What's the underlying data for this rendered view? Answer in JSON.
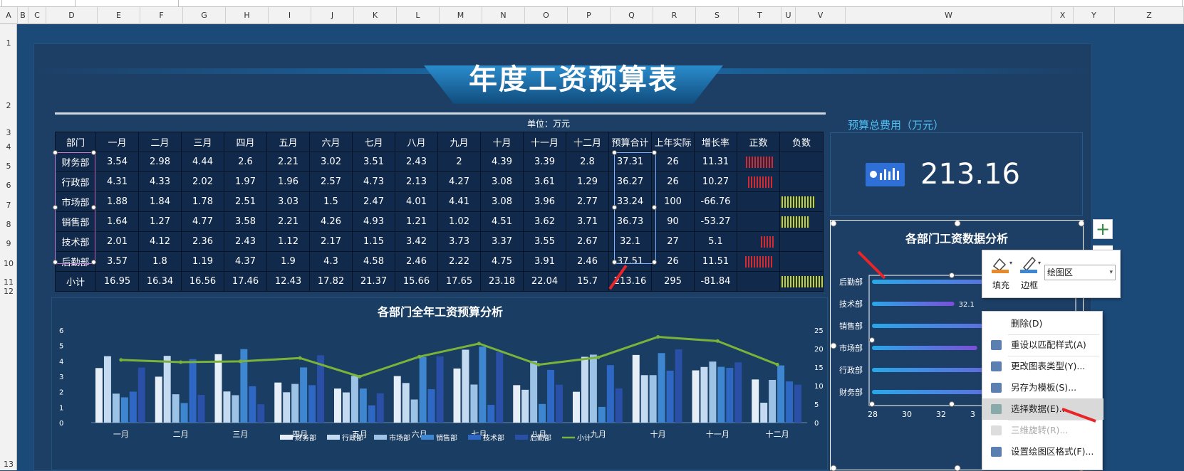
{
  "title": "年度工资预算表",
  "unit": "单位：万元",
  "columns": [
    "A",
    "B",
    "C",
    "D",
    "E",
    "F",
    "G",
    "H",
    "I",
    "J",
    "K",
    "L",
    "M",
    "N",
    "O",
    "P",
    "Q",
    "R",
    "S",
    "T",
    "U",
    "V",
    "W",
    "X",
    "Y",
    "Z"
  ],
  "rows": [
    "1",
    "2",
    "3",
    "4",
    "5",
    "6",
    "7",
    "8",
    "9",
    "10",
    "11",
    "12",
    "13"
  ],
  "table": {
    "headers": [
      "部门",
      "一月",
      "二月",
      "三月",
      "四月",
      "五月",
      "六月",
      "七月",
      "八月",
      "九月",
      "十月",
      "十一月",
      "十二月",
      "预算合计",
      "上年实际",
      "增长率",
      "正数",
      "负数"
    ],
    "rows": [
      [
        "财务部",
        "3.54",
        "2.98",
        "4.44",
        "2.6",
        "2.21",
        "3.02",
        "3.51",
        "2.43",
        "2",
        "4.39",
        "3.39",
        "2.8",
        "37.31",
        "26",
        "11.31"
      ],
      [
        "行政部",
        "4.31",
        "4.33",
        "2.02",
        "1.97",
        "1.96",
        "2.57",
        "4.73",
        "2.13",
        "4.27",
        "3.08",
        "3.61",
        "1.29",
        "36.27",
        "26",
        "10.27"
      ],
      [
        "市场部",
        "1.88",
        "1.84",
        "1.78",
        "2.51",
        "3.03",
        "1.5",
        "2.47",
        "4.01",
        "4.41",
        "3.08",
        "3.96",
        "2.77",
        "33.24",
        "100",
        "-66.76"
      ],
      [
        "销售部",
        "1.64",
        "1.27",
        "4.77",
        "3.58",
        "2.21",
        "4.26",
        "4.93",
        "1.21",
        "1.02",
        "4.51",
        "3.62",
        "3.71",
        "36.73",
        "90",
        "-53.27"
      ],
      [
        "技术部",
        "2.01",
        "4.12",
        "2.36",
        "2.43",
        "1.12",
        "2.17",
        "1.15",
        "3.42",
        "3.73",
        "3.37",
        "3.55",
        "2.67",
        "32.1",
        "27",
        "5.1"
      ],
      [
        "后勤部",
        "3.57",
        "1.8",
        "1.19",
        "4.37",
        "1.9",
        "4.3",
        "4.58",
        "2.46",
        "2.22",
        "4.75",
        "3.91",
        "2.46",
        "37.51",
        "26",
        "11.51"
      ],
      [
        "小计",
        "16.95",
        "16.34",
        "16.56",
        "17.46",
        "12.43",
        "17.82",
        "21.37",
        "15.66",
        "17.65",
        "23.18",
        "22.04",
        "15.7",
        "213.16",
        "295",
        "-81.84"
      ]
    ]
  },
  "kpi": {
    "label": "预算总费用（万元）",
    "value": "213.16"
  },
  "chart_data": [
    {
      "type": "bar",
      "title": "各部门全年工资预算分析",
      "categories": [
        "一月",
        "二月",
        "三月",
        "四月",
        "五月",
        "六月",
        "七月",
        "八月",
        "九月",
        "十月",
        "十一月",
        "十二月"
      ],
      "ylim": [
        0,
        6
      ],
      "y2lim": [
        0,
        25
      ],
      "yticks": [
        "0",
        "1",
        "2",
        "3",
        "4",
        "5",
        "6"
      ],
      "y2ticks": [
        "0",
        "5",
        "10",
        "15",
        "20",
        "25"
      ],
      "series": [
        {
          "name": "财务部",
          "values": [
            3.54,
            2.98,
            4.44,
            2.6,
            2.21,
            3.02,
            3.51,
            2.43,
            2,
            4.39,
            3.39,
            2.8
          ],
          "color": "#e6eef7"
        },
        {
          "name": "行政部",
          "values": [
            4.31,
            4.33,
            2.02,
            1.97,
            1.96,
            2.57,
            4.73,
            2.13,
            4.27,
            3.08,
            3.61,
            1.29
          ],
          "color": "#c3daf0"
        },
        {
          "name": "市场部",
          "values": [
            1.88,
            1.84,
            1.78,
            2.51,
            3.03,
            1.5,
            2.47,
            4.01,
            4.41,
            3.08,
            3.96,
            2.77
          ],
          "color": "#9cc3e6"
        },
        {
          "name": "销售部",
          "values": [
            1.64,
            1.27,
            4.77,
            3.58,
            2.21,
            4.26,
            4.93,
            1.21,
            1.02,
            4.51,
            3.62,
            3.71
          ],
          "color": "#3f86d1"
        },
        {
          "name": "技术部",
          "values": [
            2.01,
            4.12,
            2.36,
            2.43,
            1.12,
            2.17,
            1.15,
            3.42,
            3.73,
            3.37,
            3.55,
            2.67
          ],
          "color": "#2f68c4"
        },
        {
          "name": "后勤部",
          "values": [
            3.57,
            1.8,
            1.19,
            4.37,
            1.9,
            4.3,
            4.58,
            2.46,
            2.22,
            4.75,
            3.91,
            2.46
          ],
          "color": "#2a4fa6"
        },
        {
          "name": "小计",
          "type": "line",
          "axis": "right",
          "values": [
            16.95,
            16.34,
            16.56,
            17.46,
            12.43,
            17.82,
            21.37,
            15.66,
            17.65,
            23.18,
            22.04,
            15.7
          ],
          "color": "#7bb33a"
        }
      ]
    },
    {
      "type": "bar",
      "orientation": "horizontal",
      "title": "各部门工资数据分析",
      "categories": [
        "后勤部",
        "技术部",
        "销售部",
        "市场部",
        "行政部",
        "财务部"
      ],
      "values": [
        37.51,
        32.1,
        36.73,
        33.24,
        36.27,
        37.31
      ],
      "visible_labels": [
        "",
        "32.1",
        "",
        "33",
        "",
        ""
      ],
      "xlim": [
        28,
        38
      ],
      "xticks": [
        "28",
        "30",
        "32",
        "3"
      ]
    }
  ],
  "mini_toolbar": {
    "fill": "填充",
    "border": "边框",
    "select": "绘图区"
  },
  "context_menu": [
    {
      "label": "删除(D)",
      "icon": "none",
      "disabled": false
    },
    {
      "label": "重设以匹配样式(A)",
      "icon": "reset-icon",
      "disabled": false
    },
    {
      "label": "更改图表类型(Y)...",
      "icon": "chart-type-icon",
      "disabled": false
    },
    {
      "label": "另存为模板(S)...",
      "icon": "template-icon",
      "disabled": false
    },
    {
      "label": "选择数据(E)...",
      "icon": "select-data-icon",
      "disabled": false,
      "highlighted": true
    },
    {
      "label": "三维旋转(R)...",
      "icon": "rotate-3d-icon",
      "disabled": true
    },
    {
      "label": "设置绘图区格式(F)...",
      "icon": "format-icon",
      "disabled": false
    }
  ],
  "colors": {
    "background": "#1c4a78",
    "accent": "#4fc3f7",
    "positive_bar": "#d42b33",
    "negative_bar": "#c9d21c"
  }
}
